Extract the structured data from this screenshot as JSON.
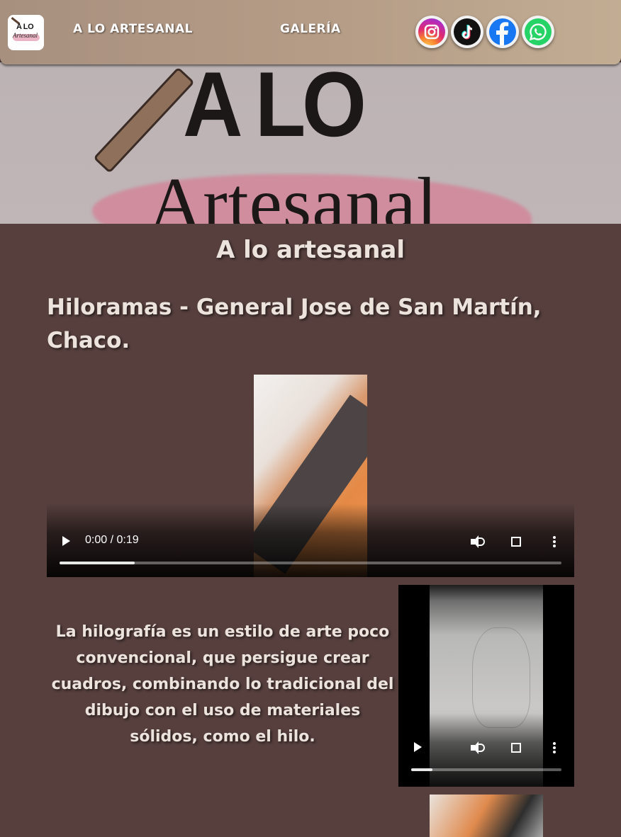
{
  "header": {
    "logo_text": "A LO",
    "logo_script": "Artesanal",
    "nav": [
      {
        "label": "A LO ARTESANAL"
      },
      {
        "label": "GALERÍA"
      }
    ],
    "social": [
      "instagram-icon",
      "tiktok-icon",
      "facebook-icon",
      "whatsapp-icon"
    ]
  },
  "hero": {
    "title": "A LO",
    "subtitle": "Artesanal"
  },
  "main": {
    "site_title": "A lo artesanal",
    "subtitle": "Hiloramas - General Jose de San Martín, Chaco.",
    "description": "La hilografía es un estilo de arte poco convencional, que persigue crear cuadros, combinando lo tradicional del dibujo con el uso de materiales sólidos, como el hilo."
  },
  "video1": {
    "time": "0:00 / 0:19",
    "progress": 0.15
  },
  "video2": {
    "progress": 0.14
  },
  "colors": {
    "page_bg": "#563f3d",
    "header_bg": "#b59d87",
    "text": "#ece3dc"
  }
}
